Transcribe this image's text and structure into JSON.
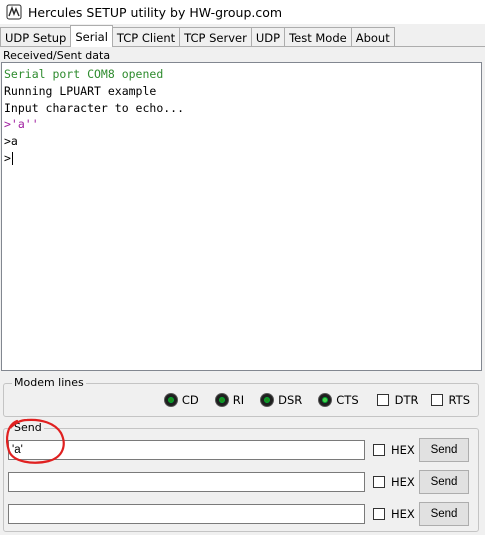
{
  "window": {
    "title": "Hercules SETUP utility by HW-group.com",
    "icon": "hercules-app-icon"
  },
  "tabs": [
    {
      "label": "UDP Setup",
      "active": false
    },
    {
      "label": "Serial",
      "active": true
    },
    {
      "label": "TCP Client",
      "active": false
    },
    {
      "label": "TCP Server",
      "active": false
    },
    {
      "label": "UDP",
      "active": false
    },
    {
      "label": "Test Mode",
      "active": false
    },
    {
      "label": "About",
      "active": false
    }
  ],
  "received": {
    "label": "Received/Sent data",
    "lines": [
      {
        "text": "Serial port COM8 opened",
        "color": "#2e8b2e"
      },
      {
        "text": "Running LPUART example",
        "color": "#000000"
      },
      {
        "text": "Input character to echo...",
        "color": "#000000"
      },
      {
        "text": ">'a''",
        "color": "#a020a0"
      },
      {
        "text": ">a",
        "color": "#000000"
      },
      {
        "text": ">",
        "color": "#000000"
      }
    ]
  },
  "modem": {
    "label": "Modem lines",
    "leds": [
      {
        "label": "CD",
        "lit": false
      },
      {
        "label": "RI",
        "lit": false
      },
      {
        "label": "DSR",
        "lit": false
      },
      {
        "label": "CTS",
        "lit": true
      }
    ],
    "checks": [
      {
        "label": "DTR",
        "checked": false
      },
      {
        "label": "RTS",
        "checked": false
      }
    ]
  },
  "send": {
    "label": "Send",
    "rows": [
      {
        "value": "'a'",
        "hex_label": "HEX",
        "button": "Send"
      },
      {
        "value": "",
        "hex_label": "HEX",
        "button": "Send"
      },
      {
        "value": "",
        "hex_label": "HEX",
        "button": "Send"
      }
    ]
  },
  "annotation": {
    "color": "#e02020",
    "shape": "hand-drawn-circle"
  }
}
